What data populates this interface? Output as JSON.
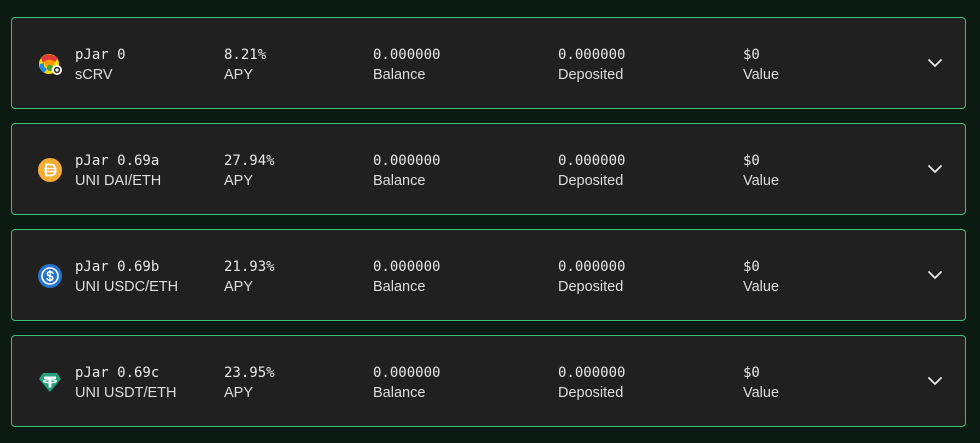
{
  "colors": {
    "page_background": "#0c1a14",
    "card_background": "#202020",
    "card_border": "#3fbf7a",
    "text_primary": "#e8e8e8"
  },
  "jars": [
    {
      "name": "pJar 0",
      "pair": "sCRV",
      "icon": "curve-rainbow-icon",
      "apy": "8.21%",
      "apy_label": "APY",
      "balance": "0.000000",
      "balance_label": "Balance",
      "deposited": "0.000000",
      "deposited_label": "Deposited",
      "value": "$0",
      "value_label": "Value",
      "expand_icon": "chevron-down-icon"
    },
    {
      "name": "pJar 0.69a",
      "pair": "UNI DAI/ETH",
      "icon": "dai-icon",
      "apy": "27.94%",
      "apy_label": "APY",
      "balance": "0.000000",
      "balance_label": "Balance",
      "deposited": "0.000000",
      "deposited_label": "Deposited",
      "value": "$0",
      "value_label": "Value",
      "expand_icon": "chevron-down-icon"
    },
    {
      "name": "pJar 0.69b",
      "pair": "UNI USDC/ETH",
      "icon": "usdc-icon",
      "apy": "21.93%",
      "apy_label": "APY",
      "balance": "0.000000",
      "balance_label": "Balance",
      "deposited": "0.000000",
      "deposited_label": "Deposited",
      "value": "$0",
      "value_label": "Value",
      "expand_icon": "chevron-down-icon"
    },
    {
      "name": "pJar 0.69c",
      "pair": "UNI USDT/ETH",
      "icon": "tether-icon",
      "apy": "23.95%",
      "apy_label": "APY",
      "balance": "0.000000",
      "balance_label": "Balance",
      "deposited": "0.000000",
      "deposited_label": "Deposited",
      "value": "$0",
      "value_label": "Value",
      "expand_icon": "chevron-down-icon"
    }
  ]
}
